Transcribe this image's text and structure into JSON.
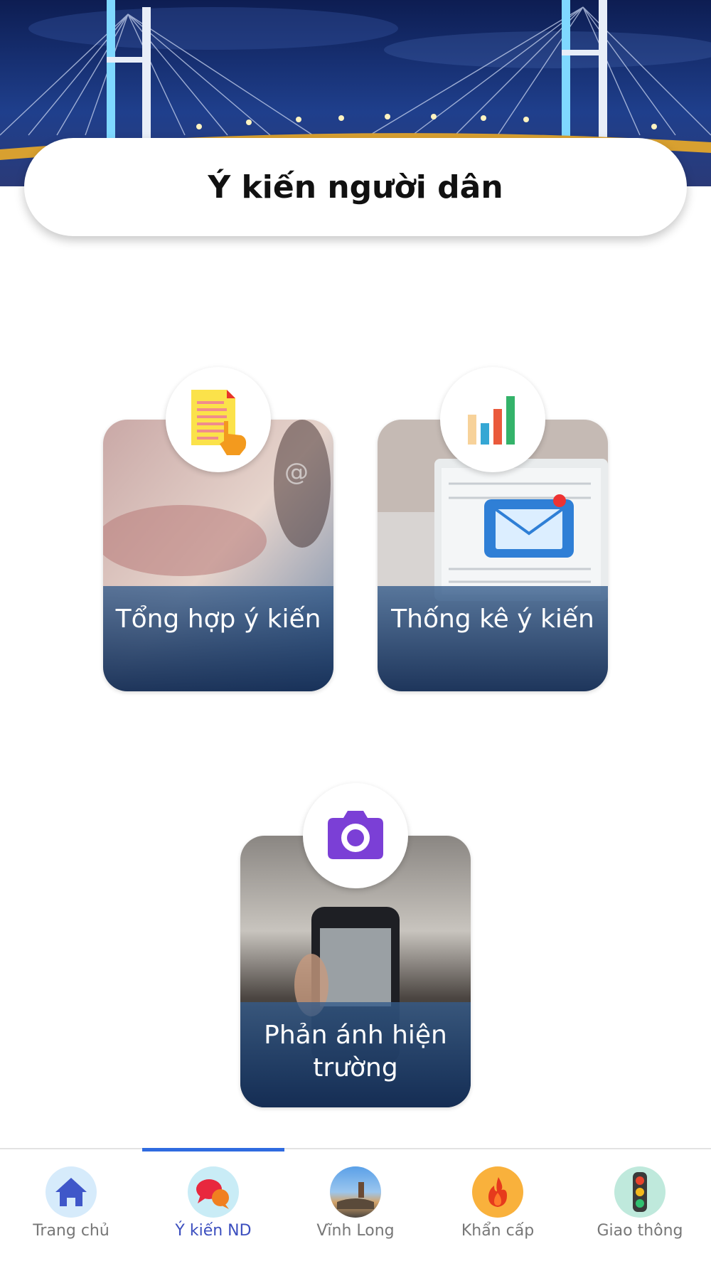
{
  "header": {
    "title": "Ý kiến người dân"
  },
  "cards": [
    {
      "label": "Tổng hợp ý kiến",
      "icon": "document-hand-icon"
    },
    {
      "label": "Thống kê ý kiến",
      "icon": "bar-chart-icon"
    },
    {
      "label": "Phản ánh hiện trường",
      "icon": "camera-icon"
    }
  ],
  "nav": {
    "active_index": 1,
    "items": [
      {
        "label": "Trang chủ",
        "icon": "home-icon"
      },
      {
        "label": "Ý kiến ND",
        "icon": "chat-bubbles-icon"
      },
      {
        "label": "Vĩnh Long",
        "icon": "landscape-photo-icon"
      },
      {
        "label": "Khẩn cấp",
        "icon": "fire-icon"
      },
      {
        "label": "Giao thông",
        "icon": "traffic-light-icon"
      }
    ]
  },
  "colors": {
    "accent": "#2f6be0",
    "active_label": "#3c4fbf",
    "inactive_label": "#777777"
  }
}
